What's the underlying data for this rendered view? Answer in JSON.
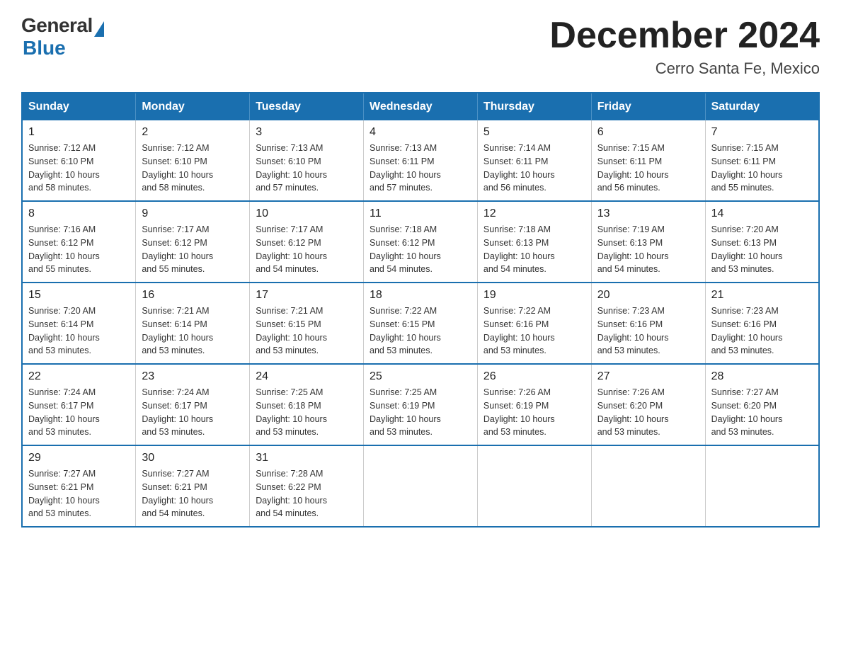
{
  "header": {
    "logo_general": "General",
    "logo_blue": "Blue",
    "month_year": "December 2024",
    "location": "Cerro Santa Fe, Mexico"
  },
  "days_of_week": [
    "Sunday",
    "Monday",
    "Tuesday",
    "Wednesday",
    "Thursday",
    "Friday",
    "Saturday"
  ],
  "weeks": [
    [
      {
        "day": "1",
        "sunrise": "7:12 AM",
        "sunset": "6:10 PM",
        "daylight": "10 hours and 58 minutes."
      },
      {
        "day": "2",
        "sunrise": "7:12 AM",
        "sunset": "6:10 PM",
        "daylight": "10 hours and 58 minutes."
      },
      {
        "day": "3",
        "sunrise": "7:13 AM",
        "sunset": "6:10 PM",
        "daylight": "10 hours and 57 minutes."
      },
      {
        "day": "4",
        "sunrise": "7:13 AM",
        "sunset": "6:11 PM",
        "daylight": "10 hours and 57 minutes."
      },
      {
        "day": "5",
        "sunrise": "7:14 AM",
        "sunset": "6:11 PM",
        "daylight": "10 hours and 56 minutes."
      },
      {
        "day": "6",
        "sunrise": "7:15 AM",
        "sunset": "6:11 PM",
        "daylight": "10 hours and 56 minutes."
      },
      {
        "day": "7",
        "sunrise": "7:15 AM",
        "sunset": "6:11 PM",
        "daylight": "10 hours and 55 minutes."
      }
    ],
    [
      {
        "day": "8",
        "sunrise": "7:16 AM",
        "sunset": "6:12 PM",
        "daylight": "10 hours and 55 minutes."
      },
      {
        "day": "9",
        "sunrise": "7:17 AM",
        "sunset": "6:12 PM",
        "daylight": "10 hours and 55 minutes."
      },
      {
        "day": "10",
        "sunrise": "7:17 AM",
        "sunset": "6:12 PM",
        "daylight": "10 hours and 54 minutes."
      },
      {
        "day": "11",
        "sunrise": "7:18 AM",
        "sunset": "6:12 PM",
        "daylight": "10 hours and 54 minutes."
      },
      {
        "day": "12",
        "sunrise": "7:18 AM",
        "sunset": "6:13 PM",
        "daylight": "10 hours and 54 minutes."
      },
      {
        "day": "13",
        "sunrise": "7:19 AM",
        "sunset": "6:13 PM",
        "daylight": "10 hours and 54 minutes."
      },
      {
        "day": "14",
        "sunrise": "7:20 AM",
        "sunset": "6:13 PM",
        "daylight": "10 hours and 53 minutes."
      }
    ],
    [
      {
        "day": "15",
        "sunrise": "7:20 AM",
        "sunset": "6:14 PM",
        "daylight": "10 hours and 53 minutes."
      },
      {
        "day": "16",
        "sunrise": "7:21 AM",
        "sunset": "6:14 PM",
        "daylight": "10 hours and 53 minutes."
      },
      {
        "day": "17",
        "sunrise": "7:21 AM",
        "sunset": "6:15 PM",
        "daylight": "10 hours and 53 minutes."
      },
      {
        "day": "18",
        "sunrise": "7:22 AM",
        "sunset": "6:15 PM",
        "daylight": "10 hours and 53 minutes."
      },
      {
        "day": "19",
        "sunrise": "7:22 AM",
        "sunset": "6:16 PM",
        "daylight": "10 hours and 53 minutes."
      },
      {
        "day": "20",
        "sunrise": "7:23 AM",
        "sunset": "6:16 PM",
        "daylight": "10 hours and 53 minutes."
      },
      {
        "day": "21",
        "sunrise": "7:23 AM",
        "sunset": "6:16 PM",
        "daylight": "10 hours and 53 minutes."
      }
    ],
    [
      {
        "day": "22",
        "sunrise": "7:24 AM",
        "sunset": "6:17 PM",
        "daylight": "10 hours and 53 minutes."
      },
      {
        "day": "23",
        "sunrise": "7:24 AM",
        "sunset": "6:17 PM",
        "daylight": "10 hours and 53 minutes."
      },
      {
        "day": "24",
        "sunrise": "7:25 AM",
        "sunset": "6:18 PM",
        "daylight": "10 hours and 53 minutes."
      },
      {
        "day": "25",
        "sunrise": "7:25 AM",
        "sunset": "6:19 PM",
        "daylight": "10 hours and 53 minutes."
      },
      {
        "day": "26",
        "sunrise": "7:26 AM",
        "sunset": "6:19 PM",
        "daylight": "10 hours and 53 minutes."
      },
      {
        "day": "27",
        "sunrise": "7:26 AM",
        "sunset": "6:20 PM",
        "daylight": "10 hours and 53 minutes."
      },
      {
        "day": "28",
        "sunrise": "7:27 AM",
        "sunset": "6:20 PM",
        "daylight": "10 hours and 53 minutes."
      }
    ],
    [
      {
        "day": "29",
        "sunrise": "7:27 AM",
        "sunset": "6:21 PM",
        "daylight": "10 hours and 53 minutes."
      },
      {
        "day": "30",
        "sunrise": "7:27 AM",
        "sunset": "6:21 PM",
        "daylight": "10 hours and 54 minutes."
      },
      {
        "day": "31",
        "sunrise": "7:28 AM",
        "sunset": "6:22 PM",
        "daylight": "10 hours and 54 minutes."
      },
      null,
      null,
      null,
      null
    ]
  ],
  "labels": {
    "sunrise": "Sunrise:",
    "sunset": "Sunset:",
    "daylight": "Daylight:"
  }
}
